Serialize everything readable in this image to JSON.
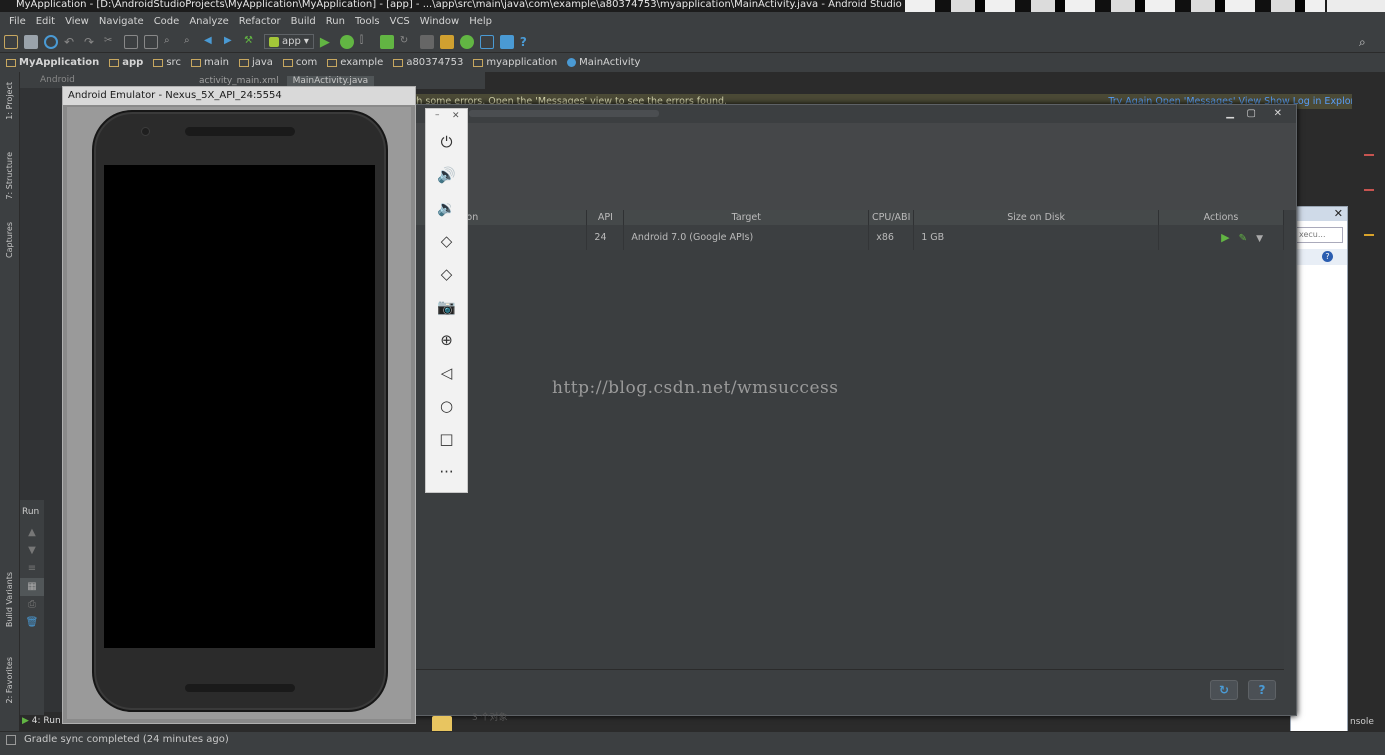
{
  "window": {
    "title": "MyApplication - [D:\\AndroidStudioProjects\\MyApplication\\MyApplication] - [app] - ...\\app\\src\\main\\java\\com\\example\\a80374753\\myapplication\\MainActivity.java - Android Studio 2.2.2"
  },
  "menu": [
    "File",
    "Edit",
    "View",
    "Navigate",
    "Code",
    "Analyze",
    "Refactor",
    "Build",
    "Run",
    "Tools",
    "VCS",
    "Window",
    "Help"
  ],
  "toolbar": {
    "run_config": "app"
  },
  "breadcrumb": [
    "MyApplication",
    "app",
    "src",
    "main",
    "java",
    "com",
    "example",
    "a80374753",
    "myapplication",
    "MainActivity"
  ],
  "project_view": {
    "mode": "Android"
  },
  "editor_tabs": [
    "activity_main.xml",
    "MainActivity.java"
  ],
  "error_banner": {
    "text": "ith some errors. Open the 'Messages' view to see the errors found.",
    "links": "Try Again   Open 'Messages' View   Show Log in Explorer"
  },
  "left_tools": {
    "project": "1: Project",
    "structure": "7: Structure",
    "captures": "Captures",
    "build_variants": "Build Variants",
    "favorites": "2: Favorites"
  },
  "run_panel": {
    "label": "Run",
    "tab": "4: Run"
  },
  "emulator": {
    "title": "Android Emulator - Nexus_5X_API_24:5554",
    "controls": [
      "power-icon",
      "volume-up-icon",
      "volume-down-icon",
      "rotate-left-icon",
      "rotate-right-icon",
      "camera-icon",
      "zoom-icon",
      "back-icon",
      "home-icon",
      "overview-icon",
      "more-icon"
    ]
  },
  "avd_manager": {
    "columns": [
      "ution",
      "API",
      "Target",
      "CPU/ABI",
      "Size on Disk",
      "Actions"
    ],
    "rows": [
      {
        "name": "",
        "api": "24",
        "target": "Android 7.0 (Google APIs)",
        "cpu": "x86",
        "size": "1 GB"
      }
    ],
    "help_label": "?"
  },
  "watermark": "http://blog.csdn.net/wmsuccess",
  "explorer": {
    "search_placeholder": "xecu..."
  },
  "bottom": {
    "status": "Gradle sync completed (24 minutes ago)",
    "items_label": "3 个对象",
    "console": "nsole"
  }
}
